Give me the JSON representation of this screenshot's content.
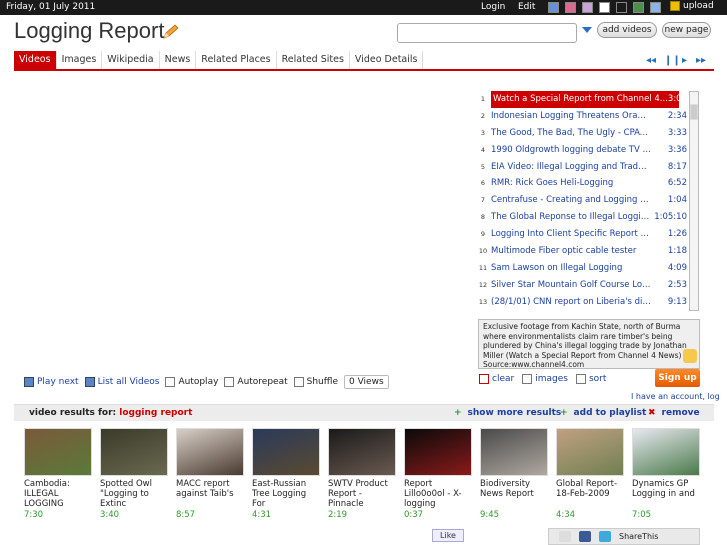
{
  "topbar": {
    "date": "Friday, 01 July 2011",
    "login": "Login",
    "edit": "Edit",
    "upload": "upload",
    "swatches": [
      "#6a8fd8",
      "#d96b8f",
      "#c9a2d6",
      "#ffffff",
      "#1a1a1a",
      "#4a8f4a",
      "#8fb0e8",
      "#9fd0a0",
      "#a0b8e0"
    ]
  },
  "header": {
    "title": "Logging Report",
    "search_value": "",
    "add_videos": "add videos",
    "new_page": "new page"
  },
  "tabs": [
    "Videos",
    "Images",
    "Wikipedia",
    "News",
    "Related Places",
    "Related Sites",
    "Video Details"
  ],
  "media_controls": [
    "prev-icon",
    "pause-icon",
    "play-icon",
    "next-icon"
  ],
  "playlist": [
    {
      "n": "1",
      "title": "Watch a Special Report from Channel 4...",
      "dur": "3:06"
    },
    {
      "n": "2",
      "title": "Indonesian Logging Threatens Orangut...",
      "dur": "2:34"
    },
    {
      "n": "3",
      "title": "The Good, The Bad, The Ugly - CPAWS...",
      "dur": "3:33"
    },
    {
      "n": "4",
      "title": "1990 Oldgrowth logging debate TV new...",
      "dur": "3:36"
    },
    {
      "n": "5",
      "title": "EIA Video: Illegal Logging and Trade of...",
      "dur": "8:17"
    },
    {
      "n": "6",
      "title": "RMR: Rick Goes Heli-Logging",
      "dur": "6:52"
    },
    {
      "n": "7",
      "title": "Centrafuse - Creating and Logging Syst...",
      "dur": "1:04"
    },
    {
      "n": "8",
      "title": "The Global Reponse to Illegal Logging ...",
      "dur": "1:05:10"
    },
    {
      "n": "9",
      "title": "Logging Into Client Specific Report Pag...",
      "dur": "1:26"
    },
    {
      "n": "10",
      "title": "Multimode Fiber optic cable tester",
      "dur": "1:18"
    },
    {
      "n": "11",
      "title": "Sam Lawson on Illegal Logging",
      "dur": "4:09"
    },
    {
      "n": "12",
      "title": "Silver Star Mountain Golf Course Loggi...",
      "dur": "2:53"
    },
    {
      "n": "13",
      "title": "(28/1/01) CNN report on Liberia's diamc...",
      "dur": "9:13"
    }
  ],
  "description": "Exclusive footage from Kachin State, north of Burma where environmentalists claim rare timber's being plundered by China's illegal logging trade by Jonathan Miller (Watch a Special Report from Channel 4 News) Source:www.channel4.com",
  "controls": {
    "play_next": "Play next",
    "list_all": "List all Videos",
    "autoplay": "Autoplay",
    "autorepeat": "Autorepeat",
    "shuffle": "Shuffle",
    "views": "0 Views"
  },
  "list_tools": {
    "clear": "clear",
    "images": "images",
    "sort": "sort",
    "signup": "Sign up",
    "account": "I have an account, log"
  },
  "results_bar": {
    "label": "video results for:",
    "term": "logging report",
    "show_more": "show more results",
    "add_playlist": "add to playlist",
    "remove": "remove"
  },
  "results": [
    {
      "title": "Cambodia: ILLEGAL LOGGING",
      "dur": "7:30",
      "colors": [
        "#7a5a3a",
        "#5a7a3a"
      ]
    },
    {
      "title": "Spotted Owl \"Logging to Extinc",
      "dur": "3:40",
      "colors": [
        "#3a3a2a",
        "#6a6a50"
      ]
    },
    {
      "title": "MACC report against Taib's",
      "dur": "8:57",
      "colors": [
        "#d8d0c8",
        "#4a3a30"
      ]
    },
    {
      "title": "East-Russian Tree Logging For",
      "dur": "4:31",
      "colors": [
        "#2a3a5a",
        "#5a4a30"
      ]
    },
    {
      "title": "SWTV Product Report - Pinnacle",
      "dur": "2:19",
      "colors": [
        "#1a1a1a",
        "#6a5a50"
      ]
    },
    {
      "title": "Report Lillo0o0ol - X-logging",
      "dur": "0:37",
      "colors": [
        "#0a0a0a",
        "#8a1a1a"
      ]
    },
    {
      "title": "Biodiversity News Report",
      "dur": "9:45",
      "colors": [
        "#4a4a4a",
        "#b0a8a0"
      ]
    },
    {
      "title": "Global Report-18-Feb-2009",
      "dur": "4:34",
      "colors": [
        "#c0a080",
        "#708050"
      ]
    },
    {
      "title": "Dynamics GP Logging in and",
      "dur": "7:05",
      "colors": [
        "#e8e8f0",
        "#4a7a4a"
      ]
    }
  ],
  "footer": {
    "like": "Like",
    "sharethis": "ShareThis"
  }
}
